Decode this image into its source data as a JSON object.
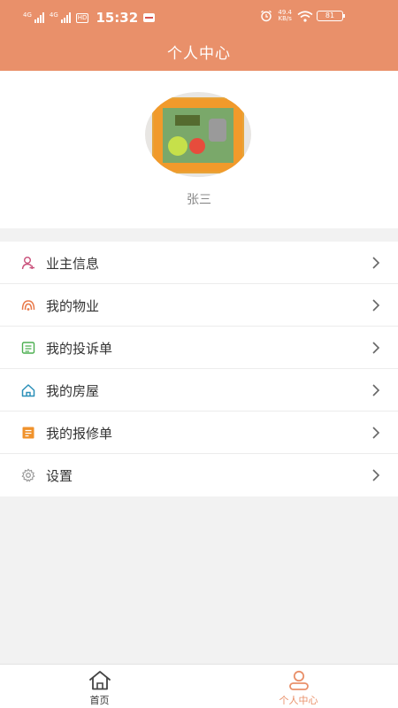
{
  "status_bar": {
    "network_1": "4G",
    "network_2": "4G",
    "hd": "HD",
    "time": "15:32",
    "speed_value": "49.4",
    "speed_unit": "KB/s",
    "battery": "81"
  },
  "header": {
    "title": "个人中心"
  },
  "profile": {
    "username": "张三"
  },
  "menu": {
    "items": [
      {
        "label": "业主信息",
        "icon": "owner-icon",
        "color": "#c9507a"
      },
      {
        "label": "我的物业",
        "icon": "property-icon",
        "color": "#e8794a"
      },
      {
        "label": "我的投诉单",
        "icon": "complaint-icon",
        "color": "#4caf50"
      },
      {
        "label": "我的房屋",
        "icon": "house-icon",
        "color": "#2a8fb8"
      },
      {
        "label": "我的报修单",
        "icon": "repair-icon",
        "color": "#f0922b"
      },
      {
        "label": "设置",
        "icon": "settings-icon",
        "color": "#999999"
      }
    ]
  },
  "tabbar": {
    "tabs": [
      {
        "label": "首页",
        "icon": "home-icon",
        "active": false
      },
      {
        "label": "个人中心",
        "icon": "profile-icon",
        "active": true
      }
    ]
  },
  "colors": {
    "accent": "#e9906a",
    "background": "#f2f2f2"
  }
}
